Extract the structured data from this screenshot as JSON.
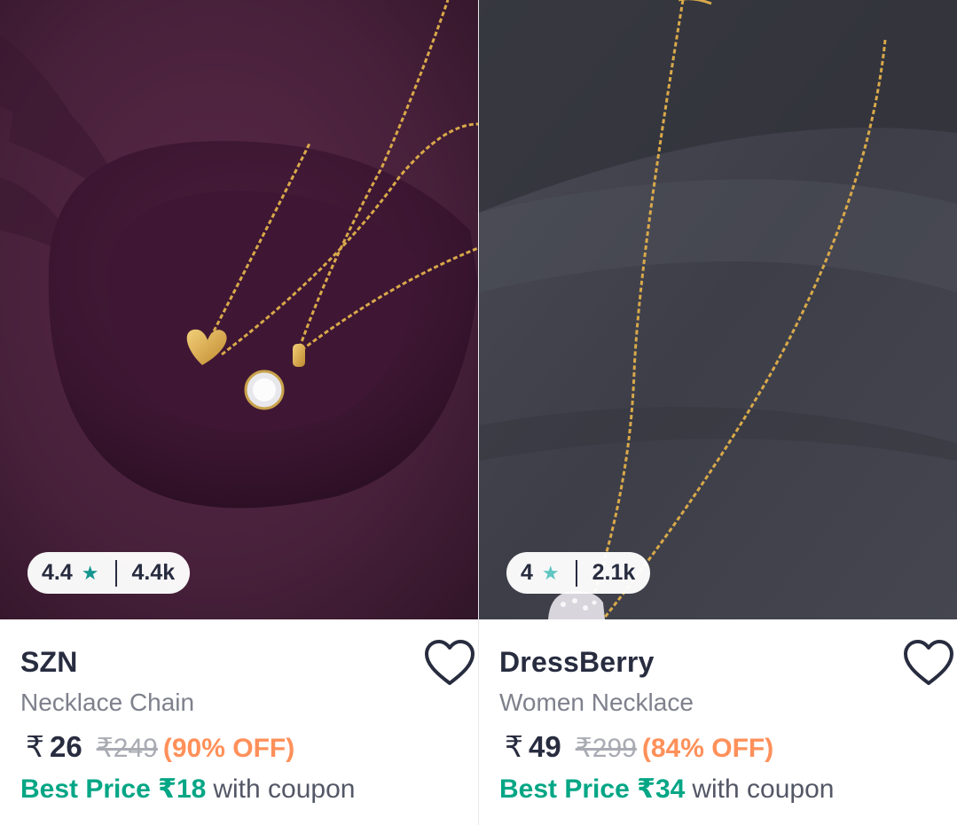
{
  "products": [
    {
      "brand": "SZN",
      "name": "Necklace Chain",
      "rating": "4.4",
      "rating_count": "4.4k",
      "rupee": "₹",
      "price": "26",
      "mrp": "₹249",
      "discount": "(90% OFF)",
      "best_price_label": "Best Price ₹18",
      "best_price_suffix": "with coupon",
      "image_desc": "gold heart and solitaire pendant necklaces on purple velvet"
    },
    {
      "brand": "DressBerry",
      "name": "Women Necklace",
      "rating": "4",
      "rating_count": "2.1k",
      "rupee": "₹",
      "price": "49",
      "mrp": "₹299",
      "discount": "(84% OFF)",
      "best_price_label": "Best Price ₹34",
      "best_price_suffix": "with coupon",
      "image_desc": "gold chain necklace with crystal pendant on dark grey fabric"
    }
  ],
  "icons": {
    "star": "star-icon",
    "wishlist": "heart-outline-icon"
  },
  "colors": {
    "rating_star": "#14958f",
    "discount": "#ff905a",
    "best_price": "#03a685",
    "text_primary": "#282c3f",
    "text_secondary": "#7e818c",
    "mrp": "#a9abb3"
  }
}
